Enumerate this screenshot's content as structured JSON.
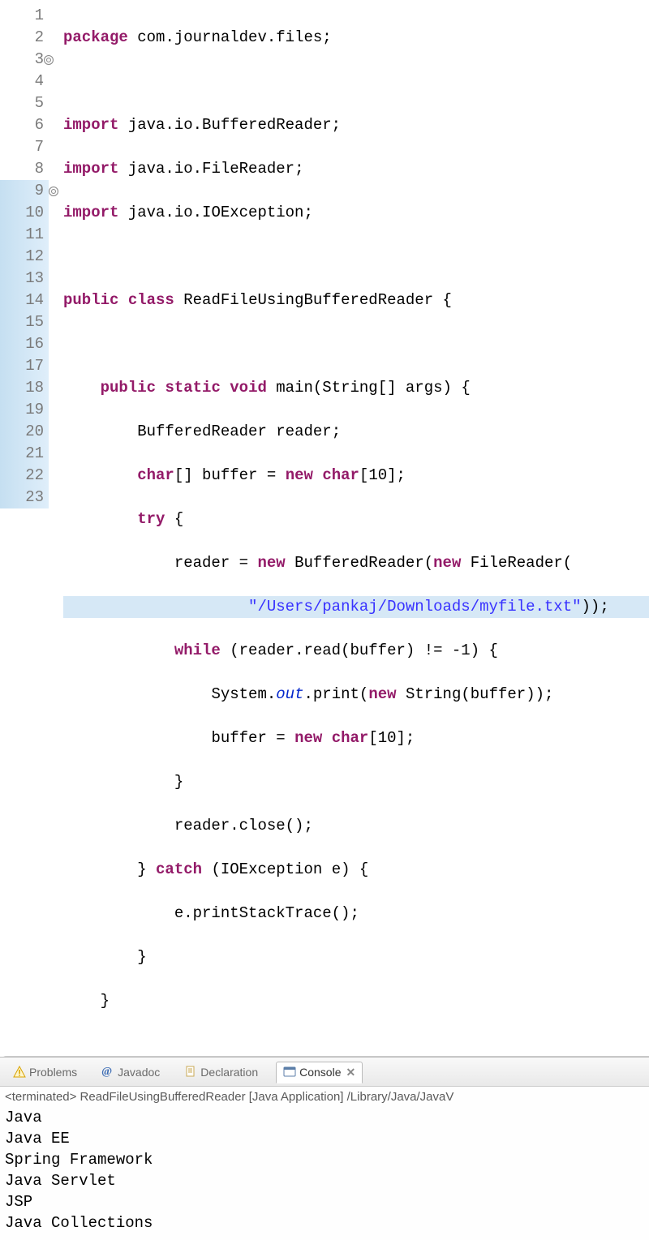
{
  "editor": {
    "line_numbers": [
      "1",
      "2",
      "3",
      "4",
      "5",
      "6",
      "7",
      "8",
      "9",
      "10",
      "11",
      "12",
      "13",
      "14",
      "15",
      "16",
      "17",
      "18",
      "19",
      "20",
      "21",
      "22",
      "23"
    ],
    "fold_lines": [
      3,
      9
    ],
    "highlighted_gutter": [
      9,
      10,
      11,
      12,
      13,
      14,
      15,
      16,
      17,
      18,
      19,
      20,
      21,
      22,
      23
    ],
    "selected_lines": [
      14
    ],
    "code": {
      "kw_package": "package",
      "pkg_name": "com.journaldev.files",
      "kw_import": "import",
      "import1": "java.io.BufferedReader",
      "import2": "java.io.FileReader",
      "import3": "java.io.IOException",
      "kw_public": "public",
      "kw_class": "class",
      "class_name": "ReadFileUsingBufferedReader",
      "kw_static": "static",
      "kw_void": "void",
      "main_name": "main",
      "brType": "BufferedReader",
      "brVar": "reader",
      "kw_char": "char",
      "bufVar": "buffer",
      "kw_new": "new",
      "ten": "10",
      "kw_try": "try",
      "frType": "FileReader",
      "path_str": "\"/Users/pankaj/Downloads/myfile.txt\"",
      "kw_while": "while",
      "read_call": "reader.read(buffer)",
      "neg1": "-1",
      "sys": "System",
      "out": "out",
      "print": "print",
      "str_type": "String",
      "close_call": "reader.close()",
      "kw_catch": "catch",
      "ioex": "IOException",
      "evar": "e",
      "pst": "e.printStackTrace()",
      "args_sig": "(String[] args)"
    }
  },
  "tabs": {
    "problems": "Problems",
    "javadoc": "Javadoc",
    "decl": "Declaration",
    "console": "Console"
  },
  "console": {
    "status": "<terminated> ReadFileUsingBufferedReader [Java Application] /Library/Java/JavaV",
    "output": [
      "Java",
      "Java EE",
      "Spring Framework",
      "Java Servlet",
      "JSP",
      "Java Collections"
    ]
  }
}
